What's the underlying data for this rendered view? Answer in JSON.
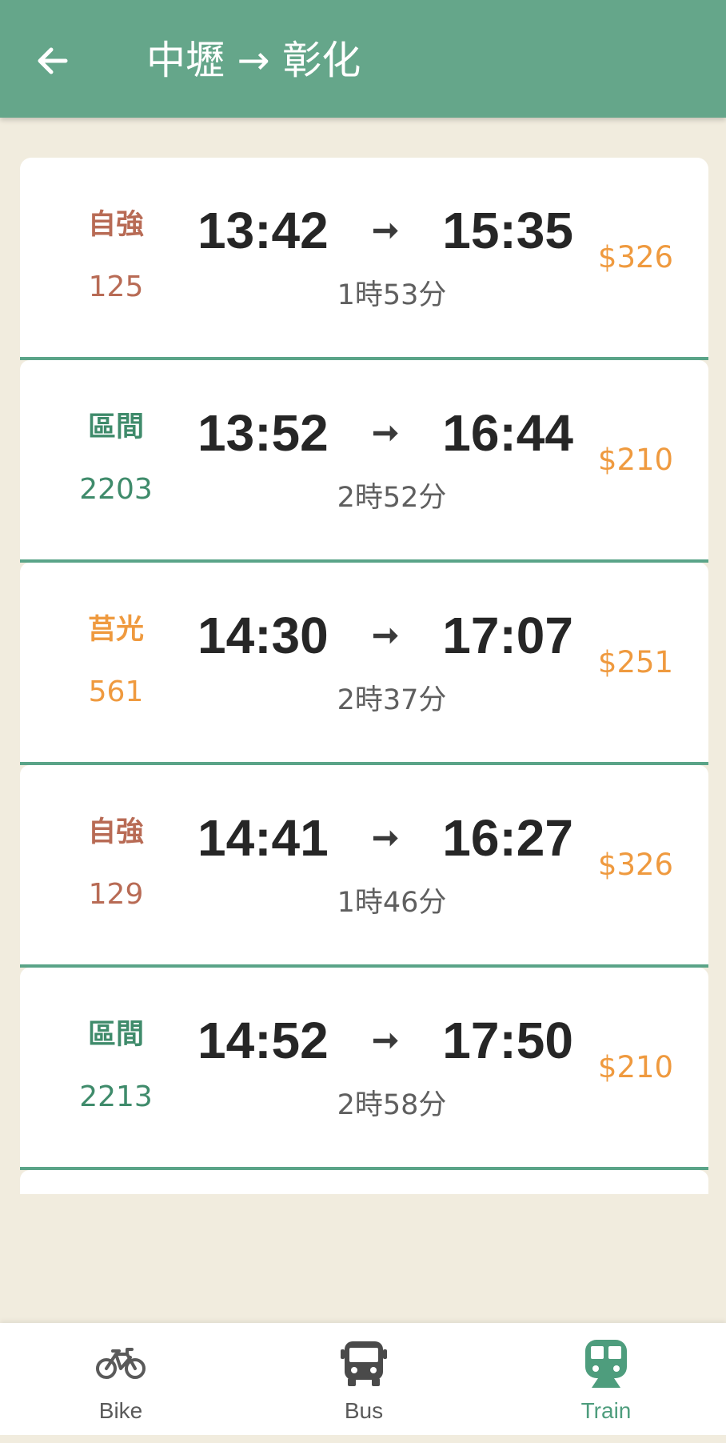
{
  "header": {
    "title": "中壢 → 彰化",
    "back_icon": "arrow-left-icon"
  },
  "trains": [
    {
      "type": "自強",
      "number": "125",
      "depart": "13:42",
      "arrive": "15:35",
      "duration": "1時53分",
      "price": "$326",
      "type_color": "#b86b55"
    },
    {
      "type": "區間",
      "number": "2203",
      "depart": "13:52",
      "arrive": "16:44",
      "duration": "2時52分",
      "price": "$210",
      "type_color": "#3f8b6b"
    },
    {
      "type": "莒光",
      "number": "561",
      "depart": "14:30",
      "arrive": "17:07",
      "duration": "2時37分",
      "price": "$251",
      "type_color": "#ef9a3f"
    },
    {
      "type": "自強",
      "number": "129",
      "depart": "14:41",
      "arrive": "16:27",
      "duration": "1時46分",
      "price": "$326",
      "type_color": "#b86b55"
    },
    {
      "type": "區間",
      "number": "2213",
      "depart": "14:52",
      "arrive": "17:50",
      "duration": "2時58分",
      "price": "$210",
      "type_color": "#3f8b6b"
    }
  ],
  "arrow_symbol": "➞",
  "bottom_nav": {
    "items": [
      {
        "label": "Bike",
        "icon": "bike-icon"
      },
      {
        "label": "Bus",
        "icon": "bus-icon"
      },
      {
        "label": "Train",
        "icon": "train-icon",
        "active": true
      }
    ]
  },
  "colors": {
    "appbar": "#65a68a",
    "background": "#f1ecde",
    "divider": "#5aa488",
    "price": "#ef9a3f",
    "active_nav": "#4e9d7d"
  }
}
